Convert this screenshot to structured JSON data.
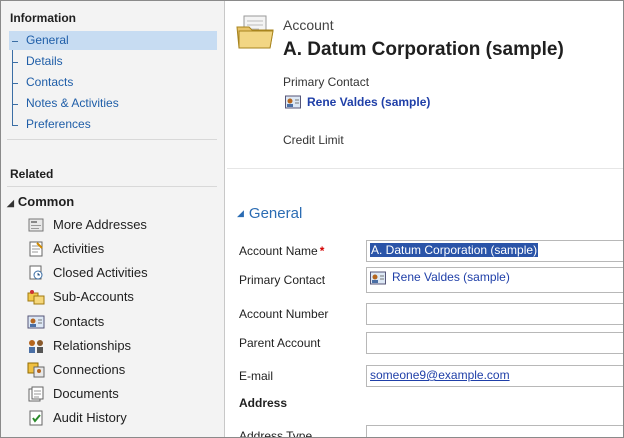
{
  "nav": {
    "information_heading": "Information",
    "info_links": [
      "General",
      "Details",
      "Contacts",
      "Notes & Activities",
      "Preferences"
    ],
    "related_heading": "Related",
    "common_heading": "Common",
    "related_items": [
      {
        "label": "More Addresses",
        "icon": "address-book-icon"
      },
      {
        "label": "Activities",
        "icon": "activities-icon"
      },
      {
        "label": "Closed Activities",
        "icon": "closed-activities-icon"
      },
      {
        "label": "Sub-Accounts",
        "icon": "sub-accounts-icon"
      },
      {
        "label": "Contacts",
        "icon": "contact-card-icon"
      },
      {
        "label": "Relationships",
        "icon": "relationships-icon"
      },
      {
        "label": "Connections",
        "icon": "connections-icon"
      },
      {
        "label": "Documents",
        "icon": "documents-icon"
      },
      {
        "label": "Audit History",
        "icon": "audit-history-icon"
      }
    ]
  },
  "header": {
    "entity_type": "Account",
    "record_title": "A. Datum Corporation (sample)",
    "primary_contact_label": "Primary Contact",
    "primary_contact_value": "Rene Valdes (sample)",
    "credit_limit_label": "Credit Limit"
  },
  "form": {
    "section_title": "General",
    "fields": [
      {
        "label": "Account Name",
        "value": "A. Datum Corporation (sample)",
        "required": "*"
      },
      {
        "label": "Primary Contact",
        "value": "Rene Valdes (sample)"
      },
      {
        "label": "Account Number",
        "value": ""
      },
      {
        "label": "Parent Account",
        "value": ""
      },
      {
        "label": "E-mail",
        "value": "someone9@example.com"
      }
    ],
    "address_heading": "Address",
    "address_type_label": "Address Type"
  },
  "colors": {
    "link": "#1f5ea8",
    "selected_nav": "#c7dcf2",
    "section_heading": "#2b6cb3",
    "required": "#d40000"
  }
}
